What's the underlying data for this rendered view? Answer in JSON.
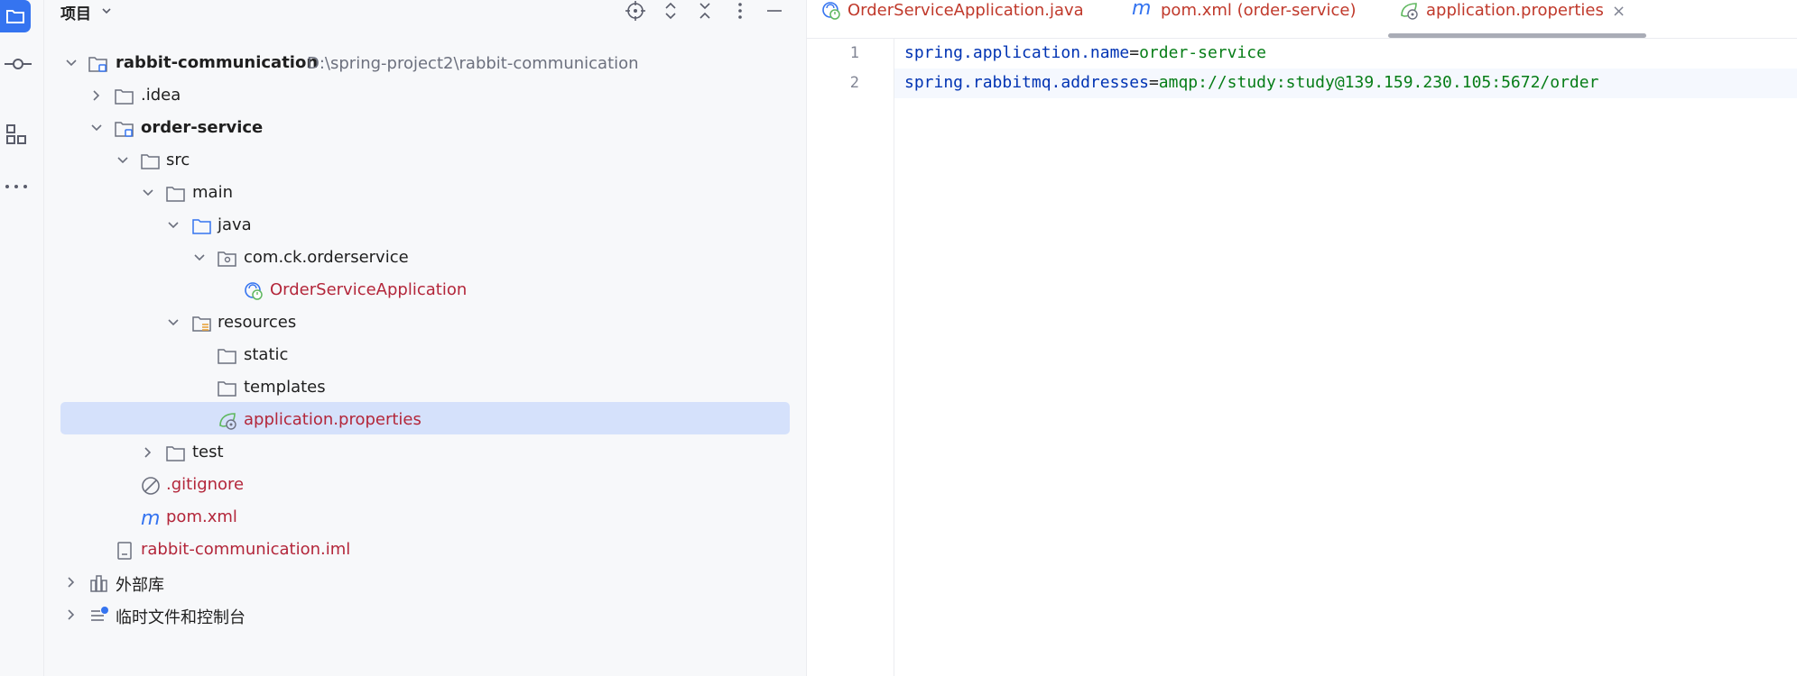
{
  "toolstrip": {
    "items": [
      {
        "name": "project-folder-icon",
        "active": true
      },
      {
        "name": "commit-icon",
        "active": false
      },
      {
        "name": "structure-icon",
        "active": false
      },
      {
        "name": "more-icon",
        "active": false
      }
    ]
  },
  "project_panel": {
    "title": "项目",
    "tree": [
      {
        "label": "rabbit-communication",
        "path": "D:\\spring-project2\\rabbit-communication",
        "icon": "module-folder-icon",
        "expanded": true,
        "bold": true
      },
      {
        "label": ".idea",
        "icon": "folder-icon",
        "expanded": false
      },
      {
        "label": "order-service",
        "icon": "module-folder-icon",
        "expanded": true,
        "bold": true
      },
      {
        "label": "src",
        "icon": "folder-icon",
        "expanded": true
      },
      {
        "label": "main",
        "icon": "folder-icon",
        "expanded": true
      },
      {
        "label": "java",
        "icon": "source-folder-icon",
        "expanded": true
      },
      {
        "label": "com.ck.orderservice",
        "icon": "package-icon",
        "expanded": true
      },
      {
        "label": "OrderServiceApplication",
        "icon": "spring-boot-class-icon"
      },
      {
        "label": "resources",
        "icon": "resources-folder-icon",
        "expanded": true
      },
      {
        "label": "static",
        "icon": "folder-icon"
      },
      {
        "label": "templates",
        "icon": "folder-icon"
      },
      {
        "label": "application.properties",
        "icon": "spring-properties-icon",
        "selected": true
      },
      {
        "label": "test",
        "icon": "folder-icon",
        "expanded": false
      },
      {
        "label": ".gitignore",
        "icon": "ignore-file-icon"
      },
      {
        "label": "pom.xml",
        "icon": "maven-icon"
      },
      {
        "label": "rabbit-communication.iml",
        "icon": "iml-file-icon"
      },
      {
        "label": "外部库",
        "icon": "library-icon",
        "expanded": false
      },
      {
        "label": "临时文件和控制台",
        "icon": "scratches-icon",
        "expanded": false
      }
    ]
  },
  "editor": {
    "tabs": [
      {
        "label": "OrderServiceApplication.java",
        "icon": "spring-boot-class-icon",
        "active": false
      },
      {
        "label": "pom.xml (order-service)",
        "icon": "maven-icon",
        "active": false
      },
      {
        "label": "application.properties",
        "icon": "spring-properties-icon",
        "active": true,
        "close": "×"
      }
    ],
    "lines": [
      {
        "number": "1",
        "key": "spring.application.name",
        "eq": "=",
        "value": "order-service"
      },
      {
        "number": "2",
        "key": "spring.rabbitmq.addresses",
        "eq": "=",
        "value": "amqp://study:study@139.159.230.105:5672/order"
      }
    ]
  },
  "colors": {
    "accent": "#3574f0",
    "selection": "#d5e1fb",
    "modified_file": "#c0392b",
    "code_key": "#0033b3",
    "code_value": "#067d17"
  }
}
